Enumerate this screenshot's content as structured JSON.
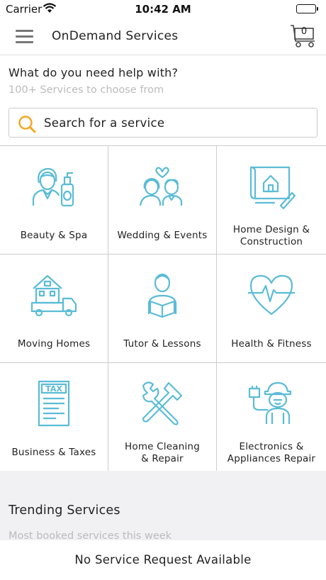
{
  "status_bar": {
    "carrier": "Carrier",
    "time": "10:42 AM"
  },
  "nav": {
    "title": "OnDemand Services",
    "cart_count": "0"
  },
  "help": {
    "title": "What do you need help with?",
    "subtitle": "100+ Services to choose from"
  },
  "search": {
    "placeholder": "Search for a service"
  },
  "services": [
    {
      "label": "Beauty & Spa",
      "icon": "beauty-spa-icon"
    },
    {
      "label": "Wedding & Events",
      "icon": "wedding-events-icon"
    },
    {
      "label": "Home Design &\nConstruction",
      "icon": "home-design-icon"
    },
    {
      "label": "Moving Homes",
      "icon": "moving-truck-icon"
    },
    {
      "label": "Tutor & Lessons",
      "icon": "tutor-icon"
    },
    {
      "label": "Health & Fitness",
      "icon": "heart-pulse-icon"
    },
    {
      "label": "Business & Taxes",
      "icon": "tax-document-icon"
    },
    {
      "label": "Home Cleaning\n& Repair",
      "icon": "wrench-hammer-icon"
    },
    {
      "label": "Electronics &\nAppliances Repair",
      "icon": "repairman-icon"
    }
  ],
  "trending": {
    "title": "Trending Services",
    "subtitle": "Most booked services this week"
  },
  "footer": {
    "message": "No Service Request Available"
  },
  "colors": {
    "icon": "#5bbcd6",
    "search_icon": "#f5a623",
    "battery": "#4cd964"
  }
}
